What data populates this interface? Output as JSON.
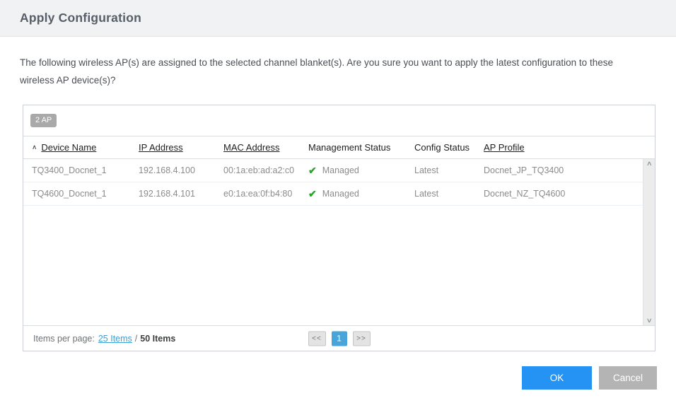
{
  "header": {
    "title": "Apply Configuration"
  },
  "message": "The following wireless AP(s) are assigned to the selected channel blanket(s). Are you sure you want to apply the latest configuration to these wireless AP device(s)?",
  "table": {
    "count_badge": "2 AP",
    "sort_indicator": "∧",
    "check_glyph": "✔",
    "columns": [
      {
        "label": "Device Name"
      },
      {
        "label": "IP Address"
      },
      {
        "label": "MAC Address"
      },
      {
        "label": "Management Status"
      },
      {
        "label": "Config Status"
      },
      {
        "label": "AP Profile"
      }
    ],
    "rows": [
      {
        "device_name": "TQ3400_Docnet_1",
        "ip_address": "192.168.4.100",
        "mac_address": "00:1a:eb:ad:a2:c0",
        "management_status": "Managed",
        "config_status": "Latest",
        "ap_profile": "Docnet_JP_TQ3400"
      },
      {
        "device_name": "TQ4600_Docnet_1",
        "ip_address": "192.168.4.101",
        "mac_address": "e0:1a:ea:0f:b4:80",
        "management_status": "Managed",
        "config_status": "Latest",
        "ap_profile": "Docnet_NZ_TQ4600"
      }
    ]
  },
  "scrollbar": {
    "up_glyph": "∧",
    "down_glyph": "∨"
  },
  "pagination": {
    "items_per_page_label": "Items per page:",
    "items_per_page_link": "25 Items",
    "separator": "/",
    "total_items": "50 Items",
    "prev_label": "<<",
    "current_page": "1",
    "next_label": ">>"
  },
  "footer": {
    "ok_label": "OK",
    "cancel_label": "Cancel"
  },
  "colors": {
    "accent_blue": "#2493f3",
    "page_active_blue": "#49a4d9",
    "link_blue": "#3aa0d6",
    "status_green": "#28a428",
    "badge_gray": "#a9a9a9",
    "cancel_gray": "#b4b4b4"
  }
}
